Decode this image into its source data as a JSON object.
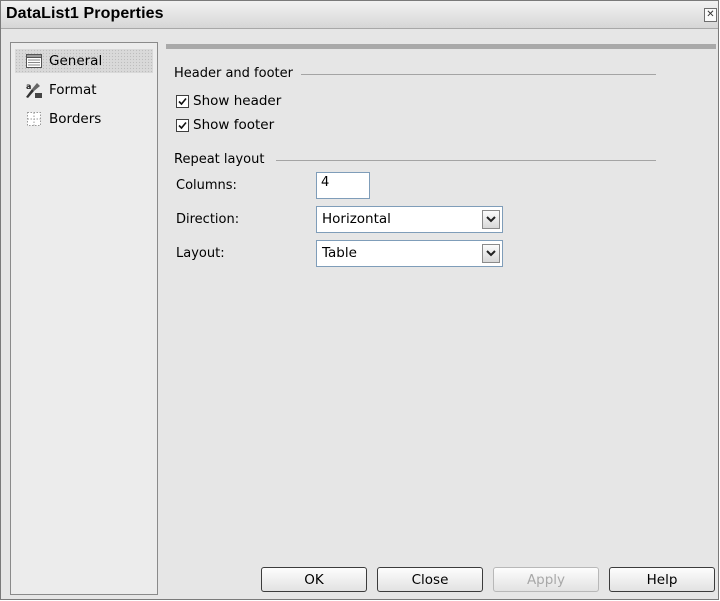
{
  "window": {
    "title": "DataList1 Properties"
  },
  "sidebar": {
    "items": [
      {
        "label": "General",
        "icon": "general-page-icon",
        "selected": true
      },
      {
        "label": "Format",
        "icon": "format-brush-icon",
        "selected": false
      },
      {
        "label": "Borders",
        "icon": "borders-grid-icon",
        "selected": false
      }
    ]
  },
  "header_footer": {
    "section_title": "Header and footer",
    "show_header": {
      "label": "Show header",
      "checked": true
    },
    "show_footer": {
      "label": "Show footer",
      "checked": true
    }
  },
  "repeat_layout": {
    "section_title": "Repeat layout",
    "columns": {
      "label": "Columns:",
      "value": "4"
    },
    "direction": {
      "label": "Direction:",
      "value": "Horizontal"
    },
    "layout": {
      "label": "Layout:",
      "value": "Table"
    }
  },
  "buttons": {
    "ok": "OK",
    "close": "Close",
    "apply": {
      "label": "Apply",
      "enabled": false
    },
    "help": "Help"
  }
}
